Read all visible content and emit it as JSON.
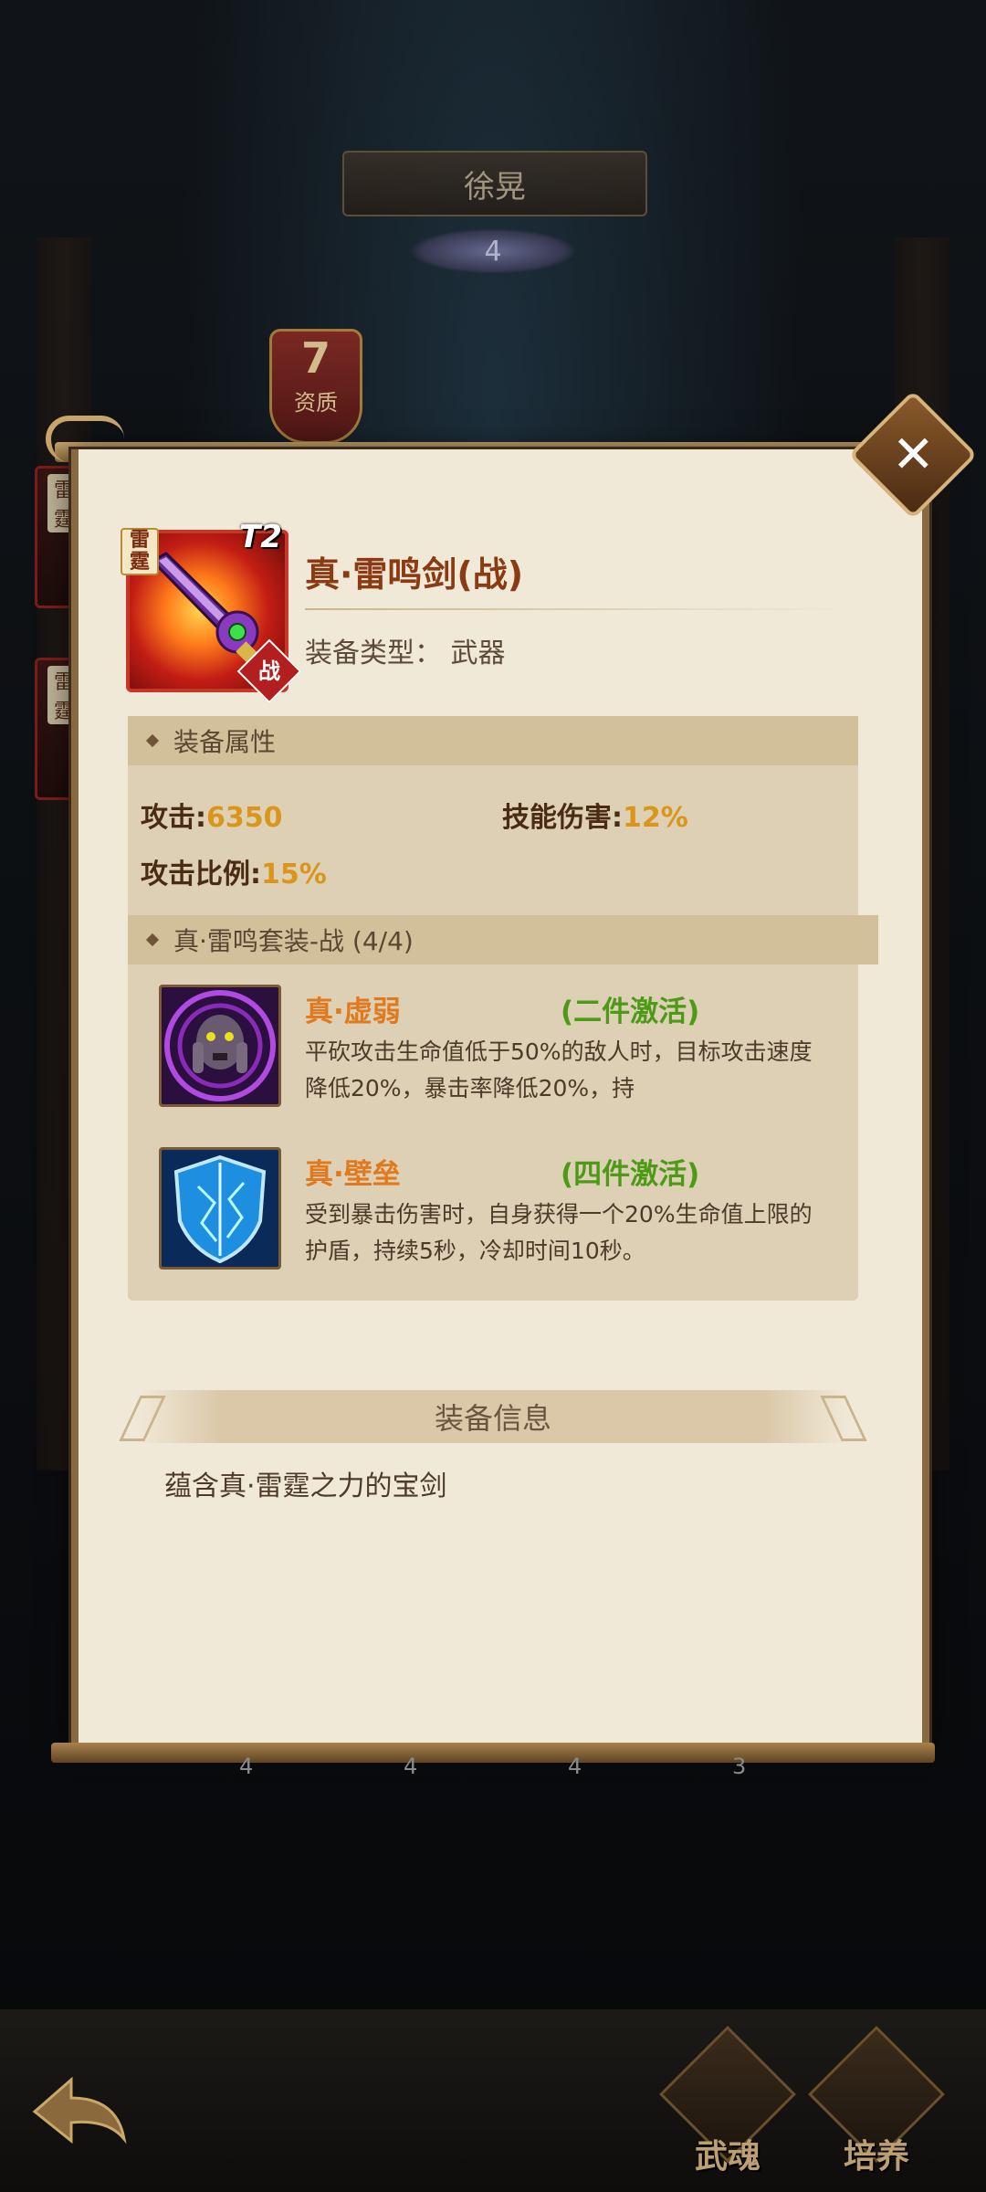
{
  "hero": {
    "name": "徐晃",
    "star": "4",
    "grade_num": "7",
    "grade_label": "资质"
  },
  "side_tags": {
    "left_a": "雷霆",
    "left_b": "雷霆",
    "right_a": "战",
    "right_b": "战",
    "right_tier": "T2"
  },
  "item": {
    "badge": "雷霆",
    "tier": "T2",
    "role": "战",
    "title": "真·雷鸣剑(战)",
    "type_label": "装备类型：",
    "type_value": "武器"
  },
  "attributes": {
    "header": "装备属性",
    "atk_label": "攻击:",
    "atk_value": "6350",
    "skill_dmg_label": "技能伤害:",
    "skill_dmg_value": "12%",
    "atk_ratio_label": "攻击比例:",
    "atk_ratio_value": "15%"
  },
  "set": {
    "header": "真·雷鸣套装-战 (4/4)",
    "skills": [
      {
        "name": "真·虚弱",
        "activation": "(二件激活)",
        "description": "平砍攻击生命值低于50%的敌人时，目标攻击速度降低20%，暴击率降低20%，持"
      },
      {
        "name": "真·壁垒",
        "activation": "(四件激活)",
        "description": "受到暴击伤害时，自身获得一个20%生命值上限的护盾，持续5秒，冷却时间10秒。"
      }
    ]
  },
  "info": {
    "header": "装备信息",
    "text": "蕴含真·雷霆之力的宝剑"
  },
  "slot_levels": [
    "4",
    "4",
    "4",
    "3"
  ],
  "nav": {
    "wuhun": "武魂",
    "peiyang": "培养"
  },
  "colors": {
    "panel": "#f1e9d8",
    "title": "#8a3b14",
    "value": "#d9961a",
    "skill_name": "#e07a20",
    "activation": "#4c9a16"
  }
}
